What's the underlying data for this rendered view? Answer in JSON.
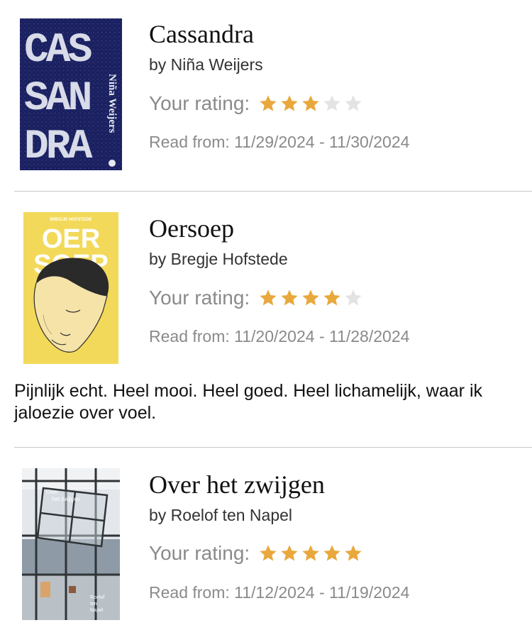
{
  "books": [
    {
      "title": "Cassandra",
      "author": "by Niña Weijers",
      "rating_label": "Your rating:",
      "rating": 3,
      "rating_max": 5,
      "read_from": "Read from: 11/29/2024 - 11/30/2024",
      "cover_text": {
        "line1": "CAS",
        "line2": "SAN",
        "line3": "DRA",
        "side": "Niña Weijers"
      }
    },
    {
      "title": "Oersoep",
      "author": "by Bregje Hofstede",
      "rating_label": "Your rating:",
      "rating": 4,
      "rating_max": 5,
      "read_from": "Read from: 11/20/2024 - 11/28/2024",
      "review": "Pijnlijk echt. Heel mooi. Heel goed. Heel lichamelijk, waar ik jaloezie over voel.",
      "cover_text": {
        "top": "BREGJE HOFSTEDE",
        "line1": "OER",
        "line2": "SOEP"
      }
    },
    {
      "title": "Over het zwijgen",
      "author": "by Roelof ten Napel",
      "rating_label": "Your rating:",
      "rating": 5,
      "rating_max": 5,
      "read_from": "Read from: 11/12/2024 - 11/19/2024",
      "cover_text": {
        "line1": "Over",
        "line2": "het zwijgen",
        "author1": "Roelof",
        "author2": "ten",
        "author3": "Napel"
      }
    }
  ],
  "colors": {
    "star_filled": "#E9A83C",
    "star_empty": "#E3E3E3",
    "muted_text": "#8A8A8A",
    "divider": "#C8C8C8"
  }
}
